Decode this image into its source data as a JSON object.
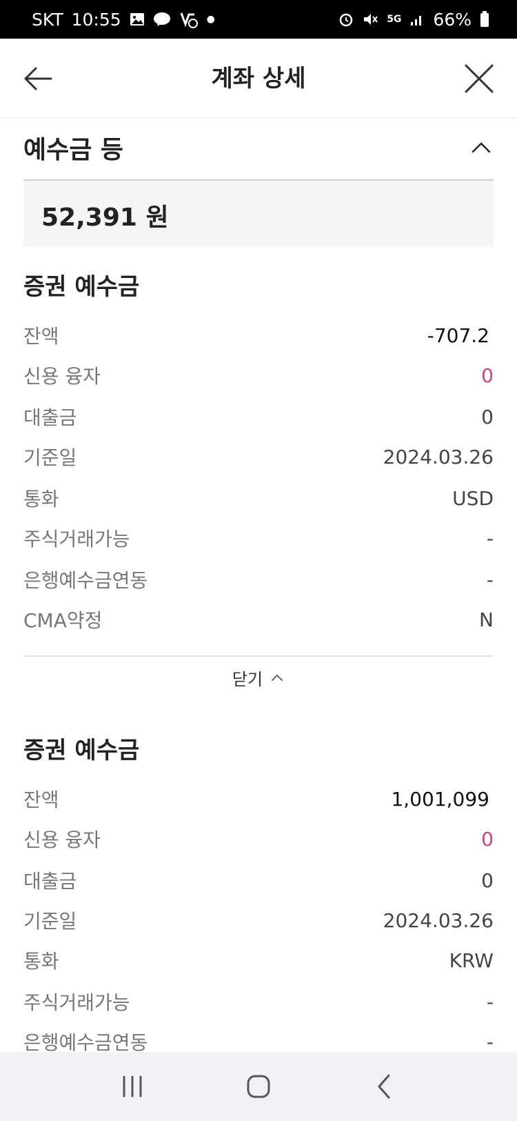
{
  "status_bar": {
    "carrier": "SKT",
    "time": "10:55",
    "network": "5G",
    "battery": "66%",
    "icons": [
      "image-icon",
      "talk-icon",
      "notification-icon",
      "alarm-icon",
      "mute-icon",
      "signal-icon",
      "battery-icon"
    ]
  },
  "header": {
    "title": "계좌 상세"
  },
  "section": {
    "title": "예수금 등",
    "total": "52,391 원"
  },
  "groups": [
    {
      "title": "증권 예수금",
      "rows": [
        {
          "label": "잔액",
          "value": "-707.2"
        },
        {
          "label": "신용 융자",
          "value": "0"
        },
        {
          "label": "대출금",
          "value": "0"
        },
        {
          "label": "기준일",
          "value": "2024.03.26"
        },
        {
          "label": "통화",
          "value": "USD"
        },
        {
          "label": "주식거래가능",
          "value": "-"
        },
        {
          "label": "은행예수금연동",
          "value": "-"
        },
        {
          "label": "CMA약정",
          "value": "N"
        }
      ]
    },
    {
      "title": "증권 예수금",
      "rows": [
        {
          "label": "잔액",
          "value": "1,001,099"
        },
        {
          "label": "신용 융자",
          "value": "0"
        },
        {
          "label": "대출금",
          "value": "0"
        },
        {
          "label": "기준일",
          "value": "2024.03.26"
        },
        {
          "label": "통화",
          "value": "KRW"
        },
        {
          "label": "주식거래가능",
          "value": "-"
        },
        {
          "label": "은행예수금연동",
          "value": "-"
        }
      ]
    }
  ],
  "collapse_label": "닫기",
  "colors": {
    "accent_pink": "#c8447c",
    "background": "#ffffff",
    "panel": "#f5f5f5"
  }
}
